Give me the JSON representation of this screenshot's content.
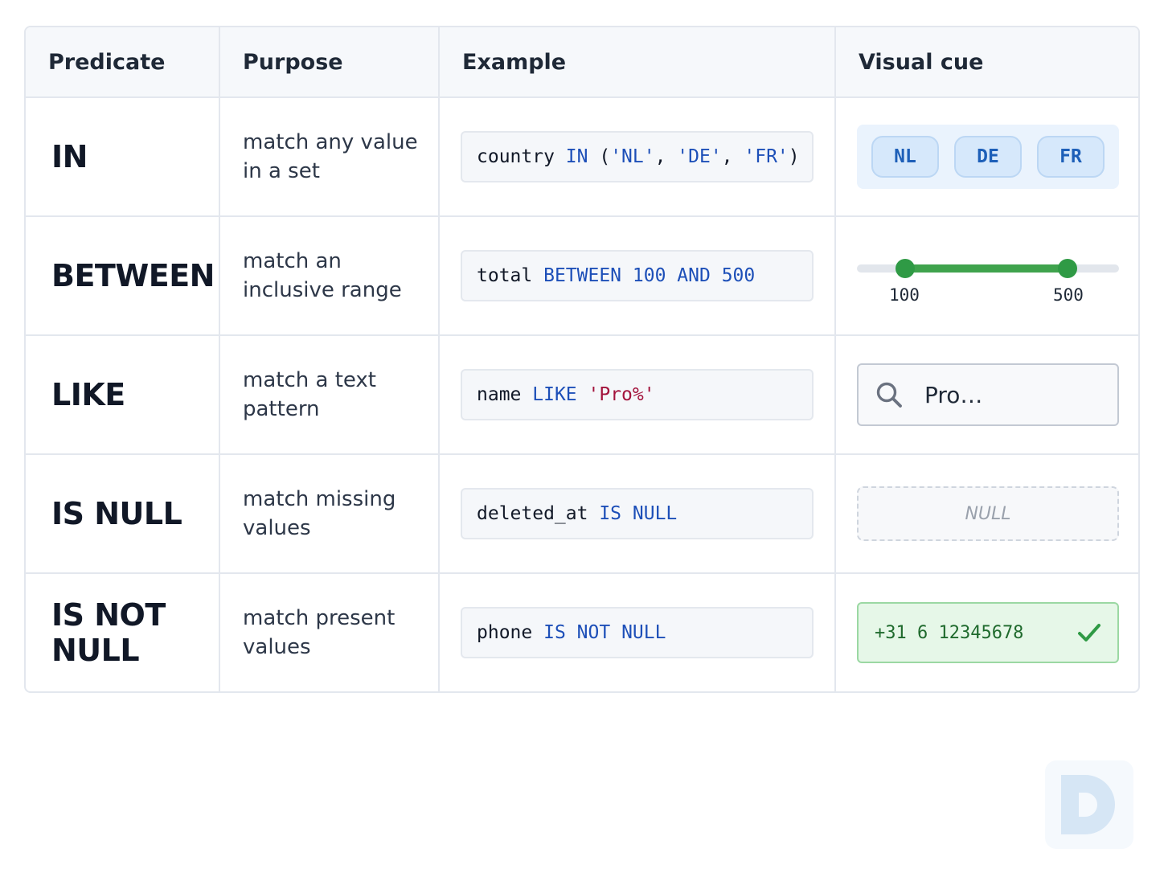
{
  "headers": [
    "Predicate",
    "Purpose",
    "Example",
    "Visual cue"
  ],
  "rows": [
    {
      "predicate": "IN",
      "purpose": "match any value in a set",
      "example": [
        {
          "t": "country ",
          "c": "plain"
        },
        {
          "t": "IN",
          "c": "kw"
        },
        {
          "t": " (",
          "c": "plain"
        },
        {
          "t": "'NL'",
          "c": "str"
        },
        {
          "t": ", ",
          "c": "plain"
        },
        {
          "t": "'DE'",
          "c": "str"
        },
        {
          "t": ", ",
          "c": "plain"
        },
        {
          "t": "'FR'",
          "c": "str"
        },
        {
          "t": ")",
          "c": "plain"
        }
      ],
      "visual": {
        "type": "chips",
        "chips": [
          "NL",
          "DE",
          "FR"
        ]
      }
    },
    {
      "predicate": "BETWEEN",
      "purpose": "match an inclusive range",
      "example": [
        {
          "t": "total ",
          "c": "plain"
        },
        {
          "t": "BETWEEN",
          "c": "kw"
        },
        {
          "t": " ",
          "c": "plain"
        },
        {
          "t": "100",
          "c": "num"
        },
        {
          "t": " ",
          "c": "plain"
        },
        {
          "t": "AND",
          "c": "kw"
        },
        {
          "t": " ",
          "c": "plain"
        },
        {
          "t": "500",
          "c": "num"
        }
      ],
      "visual": {
        "type": "slider",
        "min_label": "100",
        "max_label": "500"
      }
    },
    {
      "predicate": "LIKE",
      "purpose": "match a text pattern",
      "example": [
        {
          "t": "name ",
          "c": "plain"
        },
        {
          "t": "LIKE",
          "c": "kw"
        },
        {
          "t": " ",
          "c": "plain"
        },
        {
          "t": "'Pro%'",
          "c": "str-red"
        }
      ],
      "visual": {
        "type": "search",
        "value": "Pro…",
        "icon": "search-icon"
      }
    },
    {
      "predicate": "IS NULL",
      "purpose": "match missing values",
      "example": [
        {
          "t": "deleted_at ",
          "c": "plain"
        },
        {
          "t": "IS",
          "c": "kw"
        },
        {
          "t": " ",
          "c": "plain"
        },
        {
          "t": "NULL",
          "c": "kw"
        }
      ],
      "visual": {
        "type": "null",
        "text": "NULL"
      }
    },
    {
      "predicate": "IS NOT NULL",
      "purpose": "match present values",
      "example": [
        {
          "t": "phone ",
          "c": "plain"
        },
        {
          "t": "IS",
          "c": "kw"
        },
        {
          "t": " ",
          "c": "plain"
        },
        {
          "t": "NOT",
          "c": "kw"
        },
        {
          "t": " ",
          "c": "plain"
        },
        {
          "t": "NULL",
          "c": "kw"
        }
      ],
      "visual": {
        "type": "present",
        "text": "+31 6 12345678",
        "icon": "checkmark-icon"
      }
    }
  ],
  "colors": {
    "keyword": "#1d4fb8",
    "string_accent": "#a3133c",
    "success": "#2f9a45",
    "chip_text": "#1d5fb8"
  },
  "logo": {
    "icon": "brand-logo-icon"
  }
}
